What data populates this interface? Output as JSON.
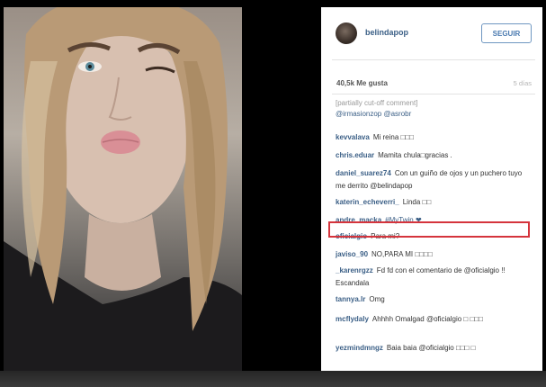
{
  "post": {
    "username": "belindapop",
    "follow_label": "SEGUIR",
    "likes": "40,5k Me gusta",
    "time": "5 días"
  },
  "comments": [
    {
      "user": "",
      "text": "[partially cut-off comment]"
    },
    {
      "user": "",
      "text": "@irmasionzop @asrobr"
    },
    {
      "user": "kevvalava",
      "text": "Mi reina □□□"
    },
    {
      "user": "chris.eduar",
      "text": "Mamita chula□gracias ."
    },
    {
      "user": "daniel_suarez74",
      "text": "Con un guiño de ojos y un puchero tuyo me derrito @belindapop"
    },
    {
      "user": "katerin_echeverri_",
      "text": "Linda □□"
    },
    {
      "user": "andre_macka",
      "text": "#MyTwin ❤"
    },
    {
      "user": "oficialgio",
      "text": "Para mi?"
    },
    {
      "user": "javiso_90",
      "text": "NO,PARA MI □□□□"
    },
    {
      "user": "_karenrgzz",
      "text": "Fd fd con el comentario de @oficialgio !! Escandala"
    },
    {
      "user": "tannya.lr",
      "text": "Omg"
    },
    {
      "user": "mcflydaly",
      "text": "Ahhhh Omalgad @oficialgio □ □□□"
    },
    {
      "user": "yezmindmngz",
      "text": "Baia baia @oficialgio □□□ □"
    }
  ],
  "highlight_color": "#d5343c",
  "link_color": "#3b5f86"
}
